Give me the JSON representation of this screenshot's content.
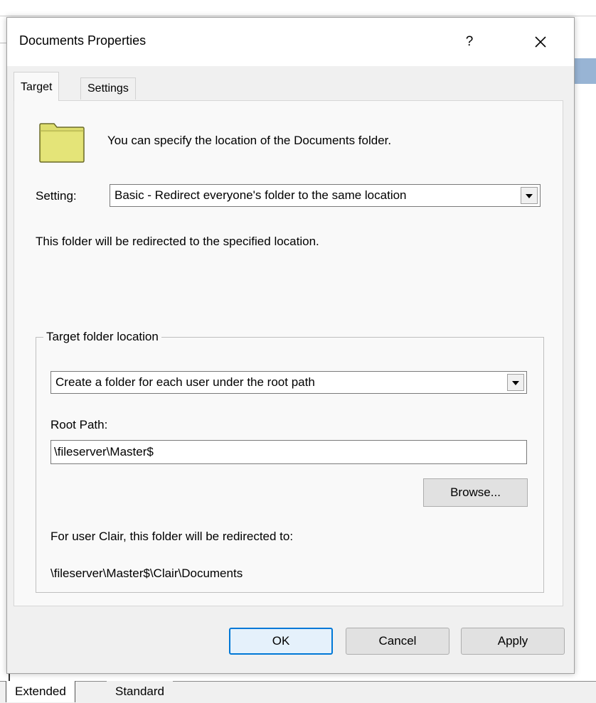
{
  "dialog": {
    "title": "Documents Properties",
    "help_label": "?",
    "close_icon": "close-icon"
  },
  "tabs": [
    {
      "label": "Target",
      "active": true
    },
    {
      "label": "Settings",
      "active": false
    }
  ],
  "target": {
    "folder_icon": "folder-icon",
    "description": "You can specify the location of the Documents folder.",
    "setting_label": "Setting:",
    "setting_value": "Basic - Redirect everyone's folder to the same location",
    "redirect_note": "This folder will be redirected to the specified location.",
    "group_legend": "Target folder location",
    "location_value": "Create a folder for each user under the root path",
    "root_path_label": "Root Path:",
    "root_path_value": "\\fileserver\\Master$",
    "browse_label": "Browse...",
    "user_note": "For user Clair, this folder will be redirected to:",
    "result_path": "\\fileserver\\Master$\\Clair\\Documents"
  },
  "buttons": {
    "ok": "OK",
    "cancel": "Cancel",
    "apply": "Apply"
  },
  "background": {
    "tabs": [
      "Extended",
      "Standard"
    ]
  },
  "colors": {
    "accent": "#0078d7",
    "folder_fill": "#dede6e",
    "dialog_bg": "#f0f0f0"
  }
}
